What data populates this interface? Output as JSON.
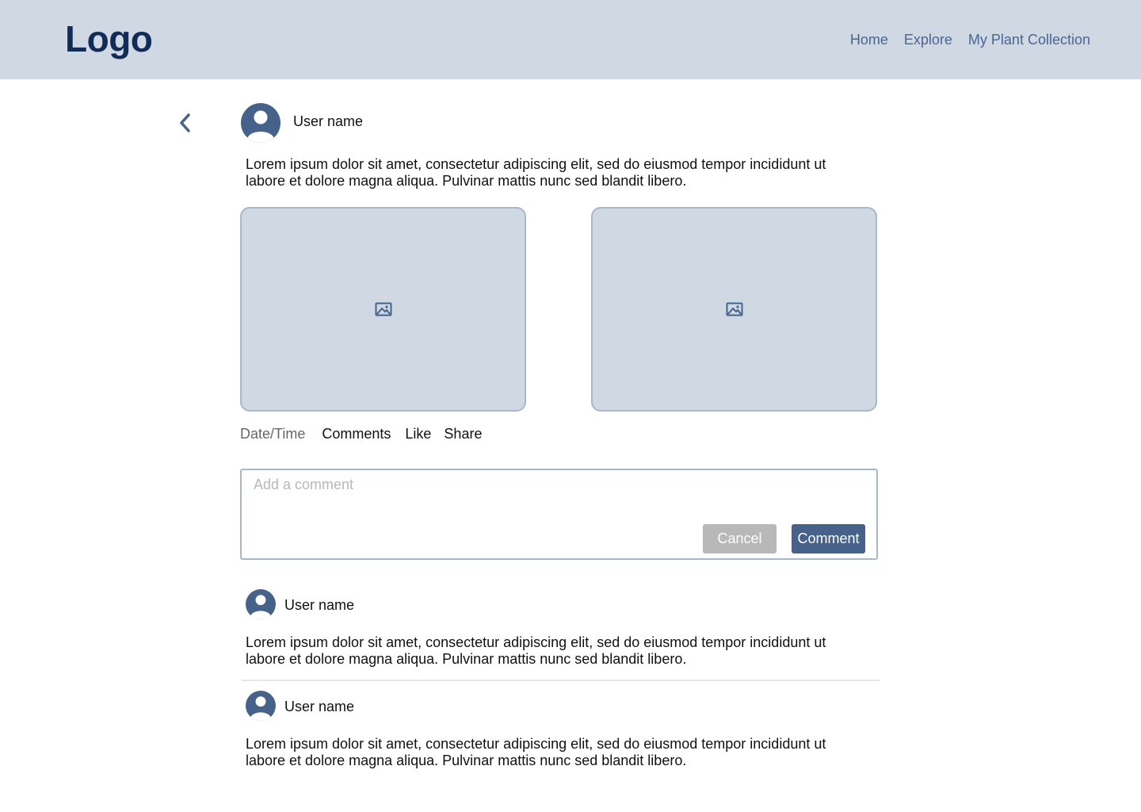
{
  "header": {
    "logo": "Logo",
    "nav": [
      "Home",
      "Explore",
      "My Plant Collection"
    ]
  },
  "post": {
    "user_name": "User name",
    "text_line1": "Lorem ipsum dolor sit amet, consectetur adipiscing elit, sed do eiusmod tempor incididunt ut",
    "text_line2": "labore et dolore magna aliqua. Pulvinar mattis nunc sed blandit libero.",
    "images": [
      "image-placeholder-icon",
      "image-placeholder-icon"
    ],
    "date_time": "Date/Time",
    "actions": [
      "Comments",
      "Like",
      "Share"
    ]
  },
  "comment_box": {
    "placeholder": "Add a comment",
    "cancel_label": "Cancel",
    "comment_label": "Comment"
  },
  "comments": [
    {
      "user_name": "User name",
      "text_line1": "Lorem ipsum dolor sit amet, consectetur adipiscing elit, sed do eiusmod tempor incididunt ut",
      "text_line2": "labore et dolore magna aliqua. Pulvinar mattis nunc sed blandit libero."
    },
    {
      "user_name": "User name",
      "text_line1": "Lorem ipsum dolor sit amet, consectetur adipiscing elit, sed do eiusmod tempor incididunt ut",
      "text_line2": "labore et dolore magna aliqua. Pulvinar mattis nunc sed blandit libero."
    }
  ],
  "colors": {
    "header_bg": "#CFD8E3",
    "logo": "#112D57",
    "accent": "#46628A",
    "muted_button": "#B8B8B8"
  }
}
